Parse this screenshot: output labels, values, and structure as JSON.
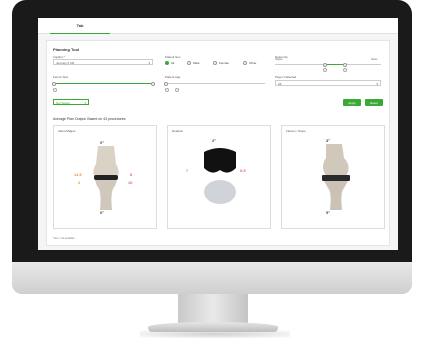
{
  "tab": {
    "label": "Tab"
  },
  "panel": {
    "title": "Planning Tool",
    "implant": {
      "label": "Implant *",
      "value": "Journey II CR"
    },
    "patient_sex": {
      "label": "Patient Sex",
      "options": [
        "All",
        "Male",
        "Female",
        "Other"
      ],
      "selected": "All"
    },
    "deformity": {
      "label": "Deformity",
      "left": "Valgus",
      "right": "Varus"
    },
    "femur_size": {
      "label": "Femur Size"
    },
    "patient_age": {
      "label": "Patient Age"
    },
    "descent": {
      "label": "Payer Collected",
      "value": "All"
    },
    "filter": {
      "label": "Not Select"
    },
    "apply_label": "Apply",
    "reset_label": "Reset",
    "subtitle": "Average Plan Output: Based on 43 procedures",
    "footnote": "*Set = not available"
  },
  "cards": [
    {
      "title": "Varus/Valgus",
      "top": "0°",
      "bottom": "0°",
      "left_val": "11.5",
      "left_sub": "2",
      "right_val": "8",
      "right_sub": "10"
    },
    {
      "title": "Rotation",
      "top": "2°",
      "left_val": "7",
      "right_val": "0.5"
    },
    {
      "title": "Flexion / Slope",
      "top": "3°",
      "bottom": "5°"
    }
  ],
  "colors": {
    "accent": "#3aa935",
    "orange": "#f28c28",
    "pink": "#d65db1"
  }
}
